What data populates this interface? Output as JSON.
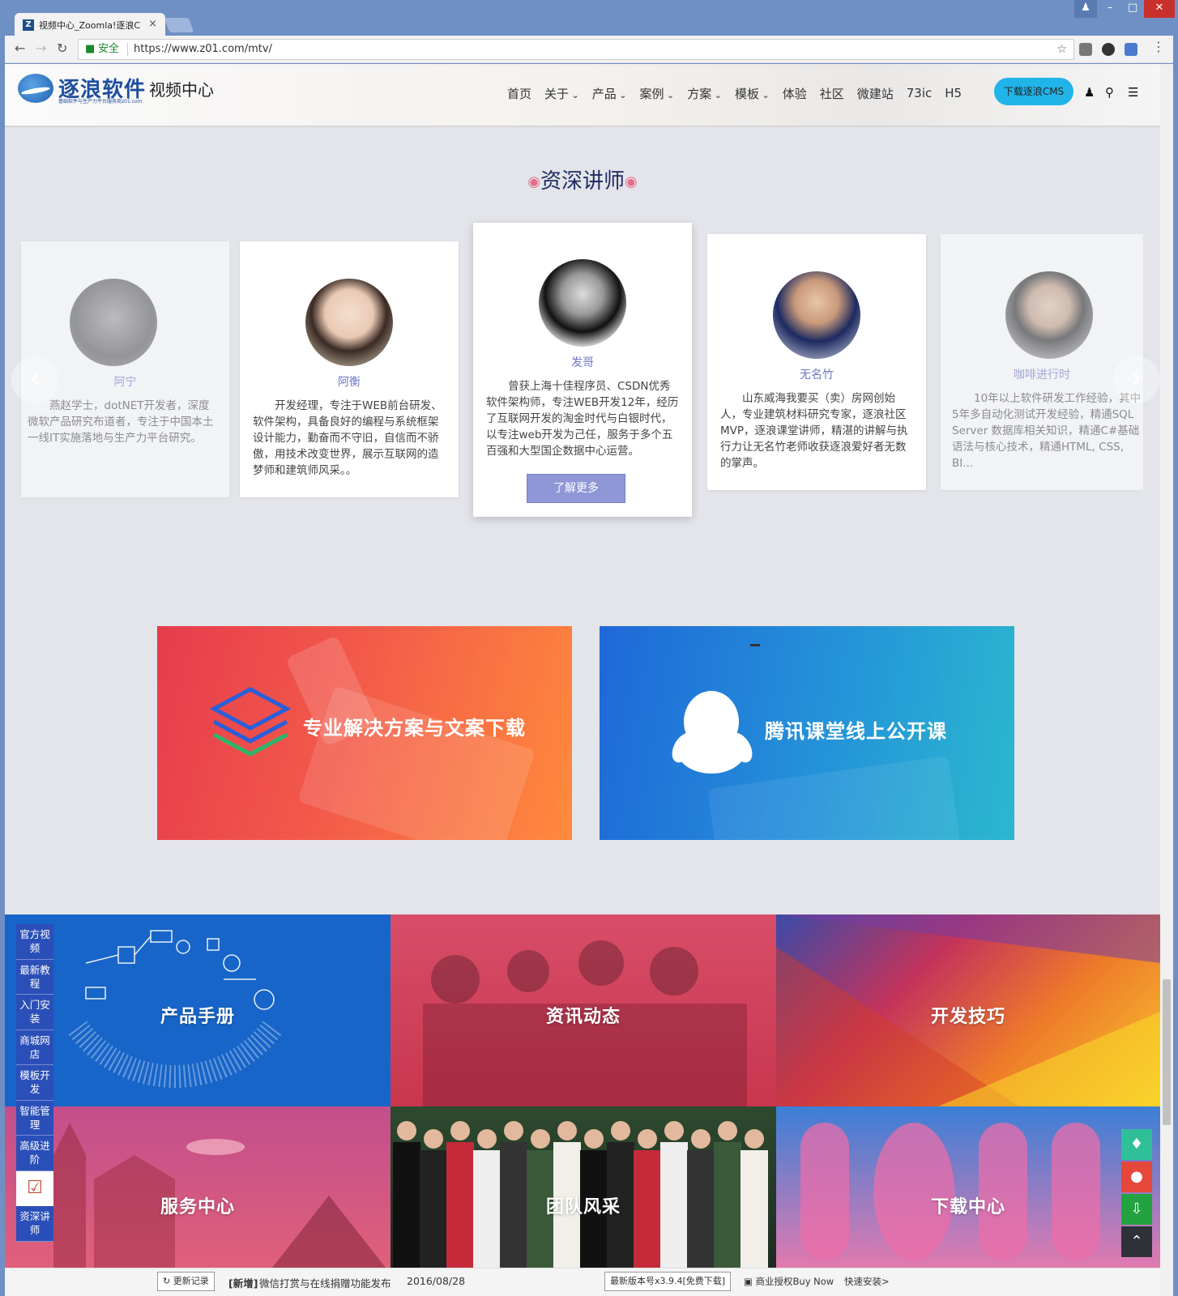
{
  "browser": {
    "tab_title": "视频中心_Zoomla!逐浪C",
    "tab_close": "×",
    "favicon": "Z",
    "secure_label": "安全",
    "url": "https://www.z01.com/mtv/"
  },
  "header": {
    "brand": "逐浪软件",
    "brand_sub": "基础软件与生产力平台服务商z01.com",
    "section": "视频中心",
    "nav": [
      {
        "label": "首页",
        "dropdown": false
      },
      {
        "label": "关于",
        "dropdown": true
      },
      {
        "label": "产品",
        "dropdown": true
      },
      {
        "label": "案例",
        "dropdown": true
      },
      {
        "label": "方案",
        "dropdown": true
      },
      {
        "label": "模板",
        "dropdown": true
      },
      {
        "label": "体验",
        "dropdown": false
      },
      {
        "label": "社区",
        "dropdown": false
      },
      {
        "label": "微建站",
        "dropdown": false
      },
      {
        "label": "73ic",
        "dropdown": false
      },
      {
        "label": "H5",
        "dropdown": false
      }
    ],
    "download_button": "下载逐浪CMS"
  },
  "teachers": {
    "title": "资深讲师",
    "more_button": "了解更多",
    "items": [
      {
        "name": "阿宁",
        "desc": "燕赵学士，dotNET开发者，深度微软产品研究布道者，专注于中国本土一线IT实施落地与生产力平台研究。"
      },
      {
        "name": "阿衡",
        "desc": "开发经理，专注于WEB前台研发、软件架构，具备良好的编程与系统框架设计能力，勤奋而不守旧，自信而不骄傲，用技术改变世界，展示互联网的造梦师和建筑师风采。。"
      },
      {
        "name": "发哥",
        "desc": "曾获上海十佳程序员、CSDN优秀软件架构师，专注WEB开发12年，经历了互联网开发的淘金时代与白银时代，以专注web开发为己任，服务于多个五百强和大型国企数据中心运营。"
      },
      {
        "name": "无名竹",
        "desc": "山东威海我要买（卖）房网创始人，专业建筑材料研究专家，逐浪社区MVP，逐浪课堂讲师，精湛的讲解与执行力让无名竹老师收获逐浪爱好者无数的掌声。"
      },
      {
        "name": "咖啡进行时",
        "desc": "10年以上软件研发工作经验，其中5年多自动化测试开发经验，精通SQL Server 数据库相关知识，精通C#基础语法与核心技术，精通HTML, CSS, BI..."
      }
    ]
  },
  "promos": [
    {
      "label": "专业解决方案与文案下载"
    },
    {
      "label": "腾讯课堂线上公开课"
    }
  ],
  "tiles": [
    {
      "label": "产品手册"
    },
    {
      "label": "资讯动态"
    },
    {
      "label": "开发技巧"
    },
    {
      "label": "服务中心"
    },
    {
      "label": "团队风采"
    },
    {
      "label": "下载中心"
    }
  ],
  "side_menu": [
    {
      "label": "官方视频"
    },
    {
      "label": "最新教程"
    },
    {
      "label": "入门安装"
    },
    {
      "label": "商城网店"
    },
    {
      "label": "模板开发"
    },
    {
      "label": "智能管理"
    },
    {
      "label": "高级进阶"
    },
    {
      "label": "资深讲师"
    }
  ],
  "bottom_bar": {
    "update_log": "更新记录",
    "news_tag": "[新增]",
    "news_text": "微信打赏与在线捐赠功能发布",
    "news_date": "2016/08/28",
    "version_button": "最新版本号x3.9.4[免费下载]",
    "license_link": "商业授权Buy Now",
    "quick_install": "快速安装>"
  },
  "colors": {
    "brand_blue": "#1d4e9e",
    "accent_cyan": "#21b4e9",
    "teacher_name": "#6c77c8",
    "more_button": "#8f97d6"
  }
}
